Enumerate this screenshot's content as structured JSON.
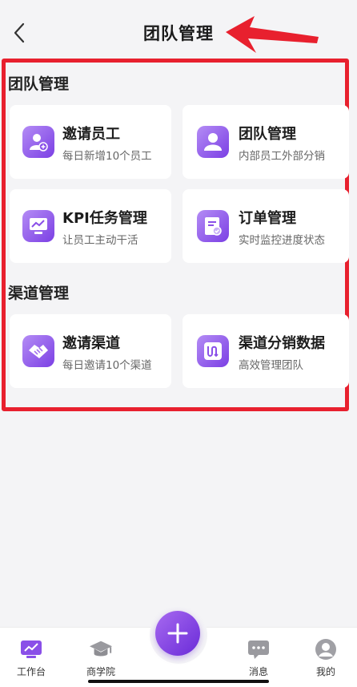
{
  "header": {
    "title": "团队管理"
  },
  "sections": [
    {
      "title": "团队管理",
      "cards": [
        {
          "title": "邀请员工",
          "subtitle": "每日新增10个员工",
          "icon": "add-user-icon"
        },
        {
          "title": "团队管理",
          "subtitle": "内部员工外部分销",
          "icon": "user-icon"
        },
        {
          "title": "KPI任务管理",
          "subtitle": "让员工主动干活",
          "icon": "chart-monitor-icon"
        },
        {
          "title": "订单管理",
          "subtitle": "实时监控进度状态",
          "icon": "order-doc-icon"
        }
      ]
    },
    {
      "title": "渠道管理",
      "cards": [
        {
          "title": "邀请渠道",
          "subtitle": "每日邀请10个渠道",
          "icon": "handshake-icon"
        },
        {
          "title": "渠道分销数据",
          "subtitle": "高效管理团队",
          "icon": "distribution-icon"
        }
      ]
    }
  ],
  "tabbar": {
    "items": [
      {
        "label": "工作台",
        "icon": "workbench-icon",
        "active": true
      },
      {
        "label": "商学院",
        "icon": "graduation-cap-icon",
        "active": false
      },
      {
        "label": "消息",
        "icon": "message-icon",
        "active": false
      },
      {
        "label": "我的",
        "icon": "profile-icon",
        "active": false
      }
    ]
  },
  "colors": {
    "accent": "#7b3fe4",
    "annotation": "#e8202e",
    "background": "#f4f4f6"
  }
}
